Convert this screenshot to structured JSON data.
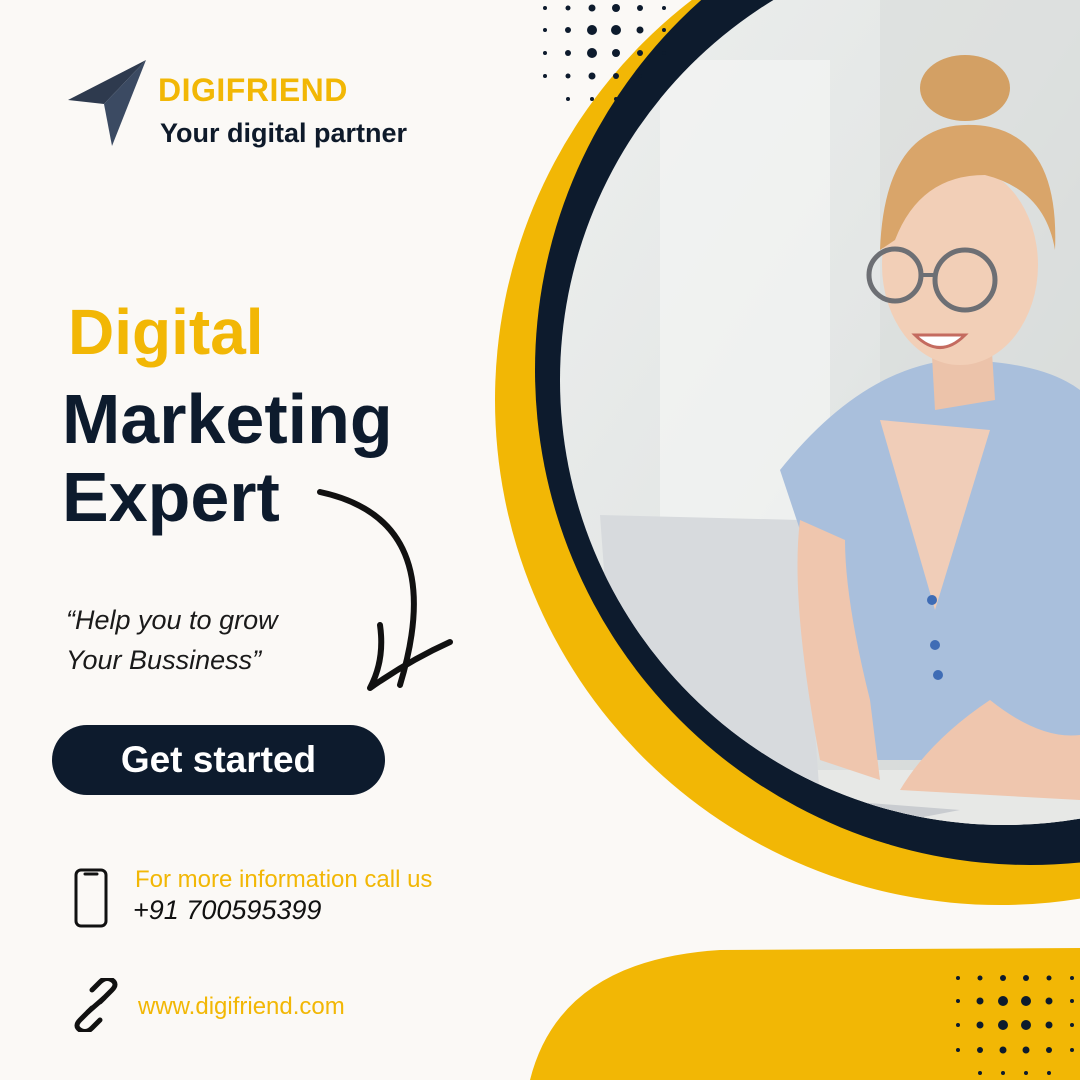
{
  "colors": {
    "accent": "#f2b705",
    "navy": "#0d1b2d"
  },
  "brand": {
    "name": "DIGIFRIEND",
    "tagline": "Your digital partner",
    "logo_icon": "paper-plane-icon"
  },
  "headline": {
    "line1": "Digital",
    "line2": "Marketing",
    "line3": "Expert"
  },
  "quote": {
    "line1": "“Help you to grow",
    "line2": "Your Bussiness”"
  },
  "cta": {
    "label": "Get started"
  },
  "contact": {
    "label": "For more information call us",
    "phone": "+91 700595399",
    "icon": "phone-icon"
  },
  "website": {
    "url": "www.digifriend.com",
    "icon": "link-icon"
  },
  "photo": {
    "subject": "woman-using-laptop"
  }
}
